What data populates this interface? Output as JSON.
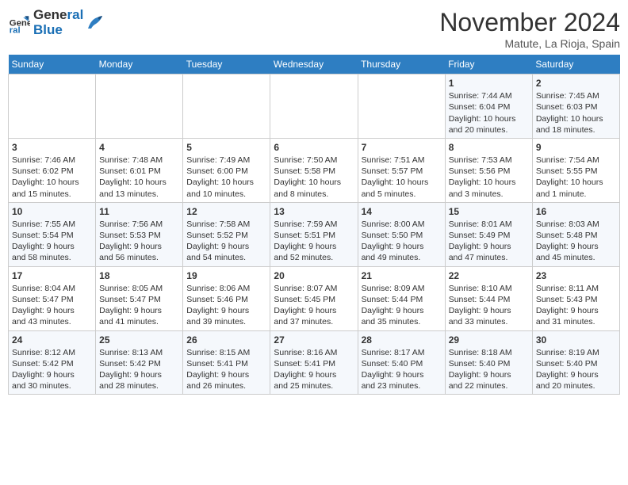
{
  "header": {
    "logo_line1": "General",
    "logo_line2": "Blue",
    "month": "November 2024",
    "location": "Matute, La Rioja, Spain"
  },
  "weekdays": [
    "Sunday",
    "Monday",
    "Tuesday",
    "Wednesday",
    "Thursday",
    "Friday",
    "Saturday"
  ],
  "weeks": [
    [
      {
        "day": "",
        "text": ""
      },
      {
        "day": "",
        "text": ""
      },
      {
        "day": "",
        "text": ""
      },
      {
        "day": "",
        "text": ""
      },
      {
        "day": "",
        "text": ""
      },
      {
        "day": "1",
        "text": "Sunrise: 7:44 AM\nSunset: 6:04 PM\nDaylight: 10 hours\nand 20 minutes."
      },
      {
        "day": "2",
        "text": "Sunrise: 7:45 AM\nSunset: 6:03 PM\nDaylight: 10 hours\nand 18 minutes."
      }
    ],
    [
      {
        "day": "3",
        "text": "Sunrise: 7:46 AM\nSunset: 6:02 PM\nDaylight: 10 hours\nand 15 minutes."
      },
      {
        "day": "4",
        "text": "Sunrise: 7:48 AM\nSunset: 6:01 PM\nDaylight: 10 hours\nand 13 minutes."
      },
      {
        "day": "5",
        "text": "Sunrise: 7:49 AM\nSunset: 6:00 PM\nDaylight: 10 hours\nand 10 minutes."
      },
      {
        "day": "6",
        "text": "Sunrise: 7:50 AM\nSunset: 5:58 PM\nDaylight: 10 hours\nand 8 minutes."
      },
      {
        "day": "7",
        "text": "Sunrise: 7:51 AM\nSunset: 5:57 PM\nDaylight: 10 hours\nand 5 minutes."
      },
      {
        "day": "8",
        "text": "Sunrise: 7:53 AM\nSunset: 5:56 PM\nDaylight: 10 hours\nand 3 minutes."
      },
      {
        "day": "9",
        "text": "Sunrise: 7:54 AM\nSunset: 5:55 PM\nDaylight: 10 hours\nand 1 minute."
      }
    ],
    [
      {
        "day": "10",
        "text": "Sunrise: 7:55 AM\nSunset: 5:54 PM\nDaylight: 9 hours\nand 58 minutes."
      },
      {
        "day": "11",
        "text": "Sunrise: 7:56 AM\nSunset: 5:53 PM\nDaylight: 9 hours\nand 56 minutes."
      },
      {
        "day": "12",
        "text": "Sunrise: 7:58 AM\nSunset: 5:52 PM\nDaylight: 9 hours\nand 54 minutes."
      },
      {
        "day": "13",
        "text": "Sunrise: 7:59 AM\nSunset: 5:51 PM\nDaylight: 9 hours\nand 52 minutes."
      },
      {
        "day": "14",
        "text": "Sunrise: 8:00 AM\nSunset: 5:50 PM\nDaylight: 9 hours\nand 49 minutes."
      },
      {
        "day": "15",
        "text": "Sunrise: 8:01 AM\nSunset: 5:49 PM\nDaylight: 9 hours\nand 47 minutes."
      },
      {
        "day": "16",
        "text": "Sunrise: 8:03 AM\nSunset: 5:48 PM\nDaylight: 9 hours\nand 45 minutes."
      }
    ],
    [
      {
        "day": "17",
        "text": "Sunrise: 8:04 AM\nSunset: 5:47 PM\nDaylight: 9 hours\nand 43 minutes."
      },
      {
        "day": "18",
        "text": "Sunrise: 8:05 AM\nSunset: 5:47 PM\nDaylight: 9 hours\nand 41 minutes."
      },
      {
        "day": "19",
        "text": "Sunrise: 8:06 AM\nSunset: 5:46 PM\nDaylight: 9 hours\nand 39 minutes."
      },
      {
        "day": "20",
        "text": "Sunrise: 8:07 AM\nSunset: 5:45 PM\nDaylight: 9 hours\nand 37 minutes."
      },
      {
        "day": "21",
        "text": "Sunrise: 8:09 AM\nSunset: 5:44 PM\nDaylight: 9 hours\nand 35 minutes."
      },
      {
        "day": "22",
        "text": "Sunrise: 8:10 AM\nSunset: 5:44 PM\nDaylight: 9 hours\nand 33 minutes."
      },
      {
        "day": "23",
        "text": "Sunrise: 8:11 AM\nSunset: 5:43 PM\nDaylight: 9 hours\nand 31 minutes."
      }
    ],
    [
      {
        "day": "24",
        "text": "Sunrise: 8:12 AM\nSunset: 5:42 PM\nDaylight: 9 hours\nand 30 minutes."
      },
      {
        "day": "25",
        "text": "Sunrise: 8:13 AM\nSunset: 5:42 PM\nDaylight: 9 hours\nand 28 minutes."
      },
      {
        "day": "26",
        "text": "Sunrise: 8:15 AM\nSunset: 5:41 PM\nDaylight: 9 hours\nand 26 minutes."
      },
      {
        "day": "27",
        "text": "Sunrise: 8:16 AM\nSunset: 5:41 PM\nDaylight: 9 hours\nand 25 minutes."
      },
      {
        "day": "28",
        "text": "Sunrise: 8:17 AM\nSunset: 5:40 PM\nDaylight: 9 hours\nand 23 minutes."
      },
      {
        "day": "29",
        "text": "Sunrise: 8:18 AM\nSunset: 5:40 PM\nDaylight: 9 hours\nand 22 minutes."
      },
      {
        "day": "30",
        "text": "Sunrise: 8:19 AM\nSunset: 5:40 PM\nDaylight: 9 hours\nand 20 minutes."
      }
    ]
  ]
}
